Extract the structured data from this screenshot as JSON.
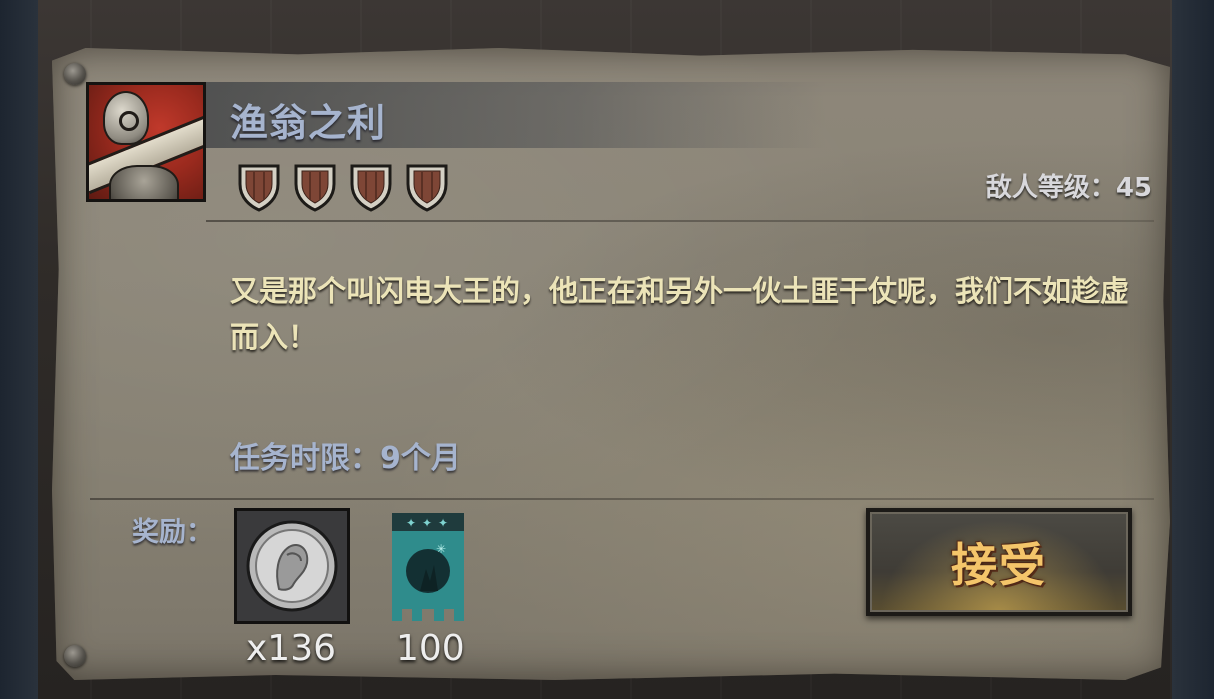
{
  "quest": {
    "title": "渔翁之利",
    "difficulty_shields": 4,
    "enemy_level_label": "敌人等级：45",
    "description": "又是那个叫闪电大王的，他正在和另外一伙土匪干仗呢，我们不如趁虚而入！",
    "time_limit": "任务时限：9个月"
  },
  "rewards": {
    "label": "奖励：",
    "items": [
      {
        "icon": "silver-coin-icon",
        "quantity": "x136"
      },
      {
        "icon": "faction-banner-icon",
        "quantity": "100"
      }
    ]
  },
  "actions": {
    "accept_label": "接受"
  },
  "colors": {
    "title": "#a6b4ce",
    "description": "#ece4b8",
    "accept": "#f4c56a",
    "portrait_bg": "#9b2a1e",
    "banner_teal": "#2f8c8c"
  }
}
